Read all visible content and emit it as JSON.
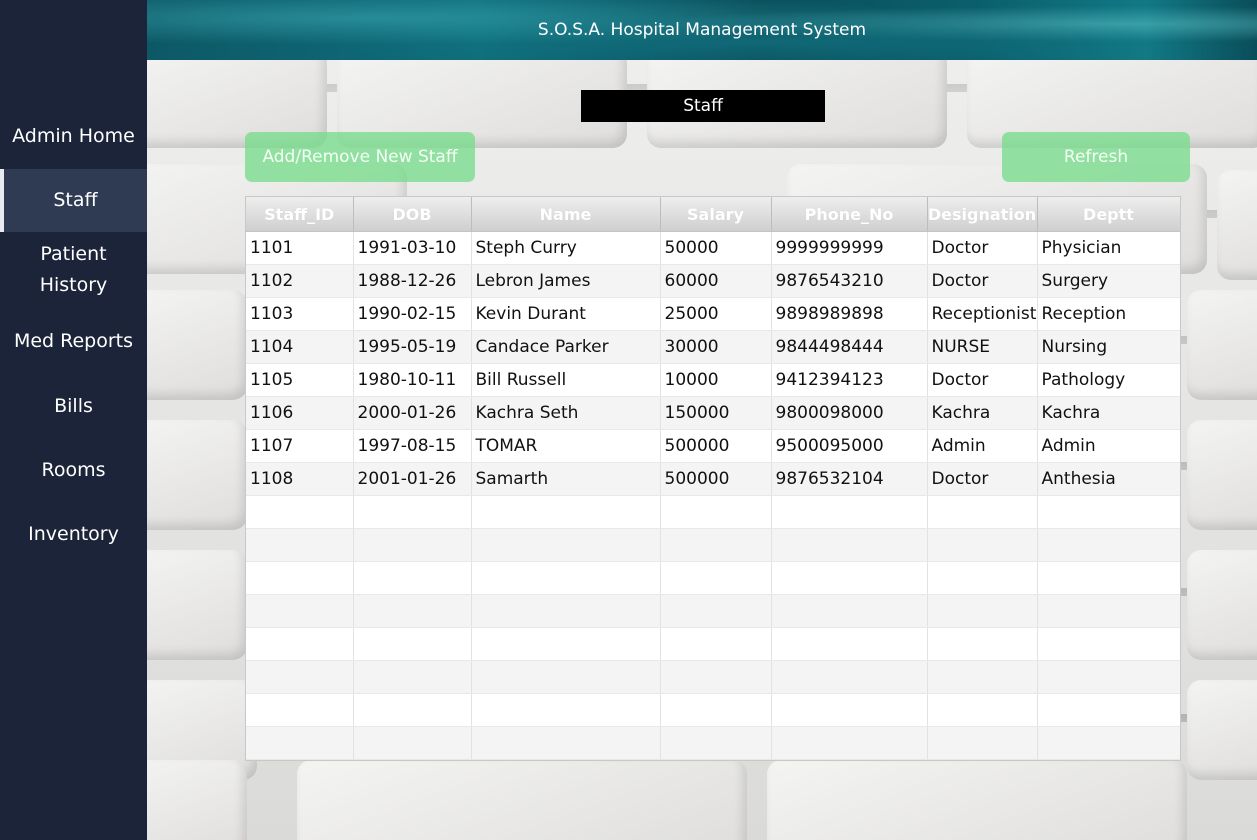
{
  "app": {
    "title": "S.O.S.A. Hospital Management System"
  },
  "sidebar": {
    "items": [
      {
        "label": "Admin Home"
      },
      {
        "label": "Staff",
        "active": true
      },
      {
        "label": "Patient\nHistory"
      },
      {
        "label": "Med Reports"
      },
      {
        "label": "Bills"
      },
      {
        "label": "Rooms"
      },
      {
        "label": "Inventory"
      }
    ]
  },
  "page": {
    "title": "Staff",
    "add_button": "Add/Remove New Staff",
    "refresh_button": "Refresh"
  },
  "table": {
    "columns": [
      "Staff_ID",
      "DOB",
      "Name",
      "Salary",
      "Phone_No",
      "Designation",
      "Deptt"
    ],
    "rows": [
      [
        "1101",
        "1991-03-10",
        "Steph Curry",
        "50000",
        "9999999999",
        "Doctor",
        "Physician"
      ],
      [
        "1102",
        "1988-12-26",
        "Lebron James",
        "60000",
        "9876543210",
        "Doctor",
        "Surgery"
      ],
      [
        "1103",
        "1990-02-15",
        "Kevin Durant",
        "25000",
        "9898989898",
        "Receptionist",
        "Reception"
      ],
      [
        "1104",
        "1995-05-19",
        "Candace Parker",
        "30000",
        "9844498444",
        "NURSE",
        "Nursing"
      ],
      [
        "1105",
        "1980-10-11",
        "Bill Russell",
        "10000",
        "9412394123",
        "Doctor",
        "Pathology"
      ],
      [
        "1106",
        "2000-01-26",
        "Kachra Seth",
        "150000",
        "9800098000",
        "Kachra",
        "Kachra"
      ],
      [
        "1107",
        "1997-08-15",
        "TOMAR",
        "500000",
        "9500095000",
        "Admin",
        "Admin"
      ],
      [
        "1108",
        "2001-01-26",
        "Samarth",
        "500000",
        "9876532104",
        "Doctor",
        "Anthesia"
      ]
    ],
    "empty_rows": 8
  },
  "colors": {
    "sidebar": "#1b2438",
    "sidebar_active": "#2e3b52",
    "button_green": "#78dc8c",
    "title_box": "#000000"
  }
}
